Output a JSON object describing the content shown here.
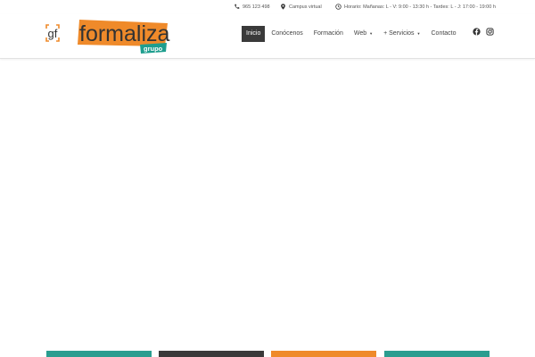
{
  "topbar": {
    "phone": "965 123 498",
    "campus": "Campus virtual",
    "schedule": "Horario: Mañanas: L - V: 9:00 - 13:30 h - Tardes: L - J: 17:00 - 19:00 h"
  },
  "logo": {
    "mark": "gf",
    "name": "formaliza",
    "tag": "grupo",
    "colors": {
      "orange": "#ef8a2a",
      "teal": "#1e9e8e",
      "text": "#333333"
    }
  },
  "nav": {
    "items": [
      {
        "label": "Inicio",
        "active": true,
        "dropdown": false
      },
      {
        "label": "Conócenos",
        "active": false,
        "dropdown": false
      },
      {
        "label": "Formación",
        "active": false,
        "dropdown": false
      },
      {
        "label": "Web",
        "active": false,
        "dropdown": true
      },
      {
        "label": "+ Servicios",
        "active": false,
        "dropdown": true
      },
      {
        "label": "Contacto",
        "active": false,
        "dropdown": false
      }
    ],
    "caret_glyph": "▼"
  },
  "social": [
    "facebook-icon",
    "instagram-icon"
  ],
  "cards": [
    {
      "color": "#2a9d8f"
    },
    {
      "color": "#3a3a3a"
    },
    {
      "color": "#ef8a2a"
    },
    {
      "color": "#2a9d8f"
    }
  ]
}
